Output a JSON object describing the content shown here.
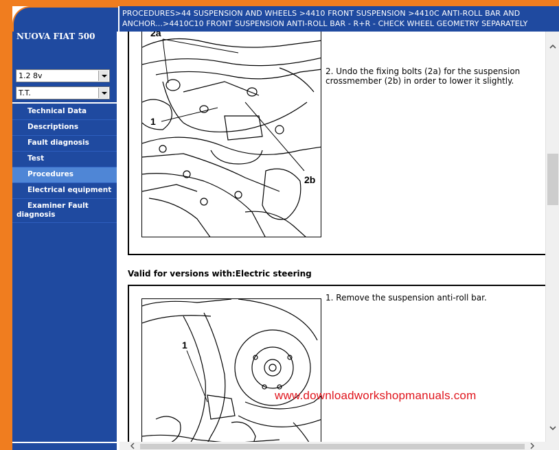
{
  "header": {
    "breadcrumb": "PROCEDURES>44 SUSPENSION AND WHEELS >4410 FRONT SUSPENSION >4410C ANTI-ROLL BAR AND ANCHOR...>4410C10 FRONT SUSPENSION ANTI-ROLL BAR - R+R - CHECK WHEEL GEOMETRY SEPARATELY"
  },
  "sidebar": {
    "title": "NUOVA FIAT 500",
    "engine_select": "1.2 8v",
    "gearbox_select": "T.T.",
    "items": [
      {
        "label": "Technical Data"
      },
      {
        "label": "Descriptions"
      },
      {
        "label": "Fault diagnosis"
      },
      {
        "label": "Test"
      },
      {
        "label": "Procedures"
      },
      {
        "label": "Electrical equipment"
      },
      {
        "label": "Examiner Fault diagnosis"
      }
    ]
  },
  "main": {
    "step_a": {
      "text": "2. Undo the fixing bolts (2a) for the suspension crossmember (2b) in order to lower it slightly.",
      "callouts": [
        "2a",
        "1",
        "2b"
      ]
    },
    "valid_title": "Valid for versions with:Electric steering",
    "step_b": {
      "text": "1. Remove the suspension anti-roll bar.",
      "callouts": [
        "1"
      ]
    },
    "watermark": "www.downloadworkshopmanuals.com"
  },
  "colors": {
    "orange": "#f07d1f",
    "navy": "#1f4aa0",
    "active_item": "#4f86d6",
    "watermark_red": "#e0141c"
  },
  "icons": {
    "dropdown": "chevron-down-icon",
    "scroll_up": "chevron-up-icon",
    "scroll_down": "chevron-down-icon",
    "scroll_left": "chevron-left-icon",
    "scroll_right": "chevron-right-icon"
  }
}
